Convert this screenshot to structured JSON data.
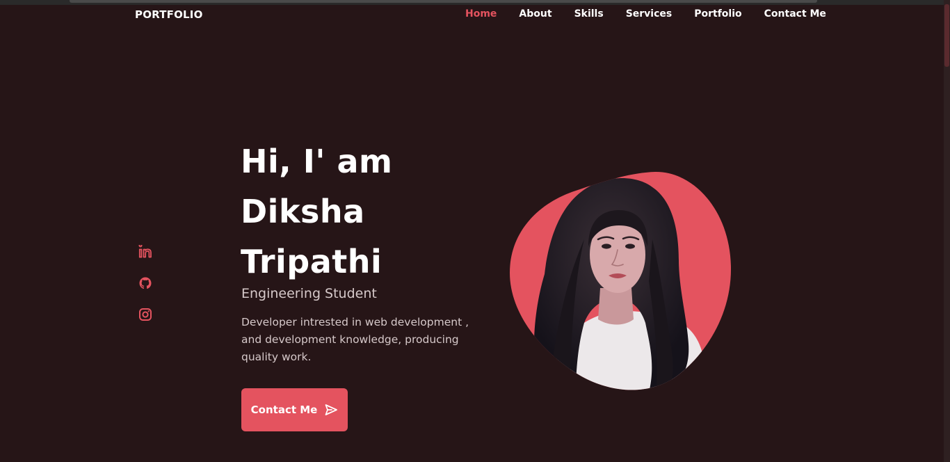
{
  "header": {
    "logo": "PORTFOLIO",
    "nav": [
      {
        "label": "Home",
        "active": true
      },
      {
        "label": "About"
      },
      {
        "label": "Skills"
      },
      {
        "label": "Services"
      },
      {
        "label": "Portfolio"
      },
      {
        "label": "Contact Me"
      }
    ]
  },
  "social": [
    {
      "icon": "linkedin-icon"
    },
    {
      "icon": "github-icon"
    },
    {
      "icon": "instagram-icon"
    }
  ],
  "hero": {
    "line1": "Hi, I' am",
    "line2": "Diksha",
    "line3": "Tripathi",
    "subtitle": "Engineering Student",
    "description": "Developer intrested in web development , and development knowledge, producing quality work.",
    "button_label": "Contact Me"
  },
  "colors": {
    "background": "#261517",
    "accent": "#e4535f",
    "text_muted": "#d6c9ca"
  }
}
